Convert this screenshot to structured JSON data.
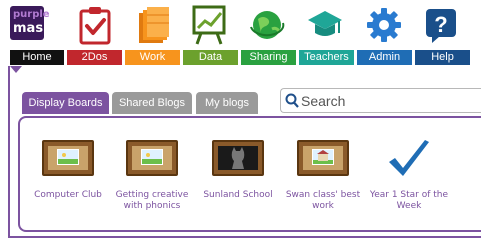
{
  "brand": {
    "line1": "purple",
    "line2": "mash"
  },
  "nav": {
    "items": [
      {
        "label": "Home",
        "color": "#111111",
        "icon": "purple-mash-logo"
      },
      {
        "label": "2Dos",
        "color": "#c1272d",
        "icon": "checklist-icon"
      },
      {
        "label": "Work",
        "color": "#f7941d",
        "icon": "folders-icon"
      },
      {
        "label": "Data",
        "color": "#6ca12d",
        "icon": "chart-board-icon"
      },
      {
        "label": "Sharing",
        "color": "#2aa140",
        "icon": "globe-icon"
      },
      {
        "label": "Teachers",
        "color": "#1fa697",
        "icon": "mortarboard-icon"
      },
      {
        "label": "Admin",
        "color": "#1f6db5",
        "icon": "gear-icon"
      },
      {
        "label": "Help",
        "color": "#1a4f8a",
        "icon": "question-icon"
      }
    ]
  },
  "tabs": [
    {
      "label": "Display Boards",
      "active": true
    },
    {
      "label": "Shared Blogs",
      "active": false
    },
    {
      "label": "My blogs",
      "active": false
    }
  ],
  "search": {
    "placeholder": "Search"
  },
  "boards": [
    {
      "label": "Computer Club",
      "icon": "display-board-icon"
    },
    {
      "label": "Getting creative with phonics",
      "icon": "display-board-icon"
    },
    {
      "label": "Sunland School",
      "icon": "dark-display-board-icon"
    },
    {
      "label": "Swan class' best work",
      "icon": "school-display-board-icon"
    },
    {
      "label": "Year 1 Star of the Week",
      "icon": "checkmark-icon"
    }
  ]
}
